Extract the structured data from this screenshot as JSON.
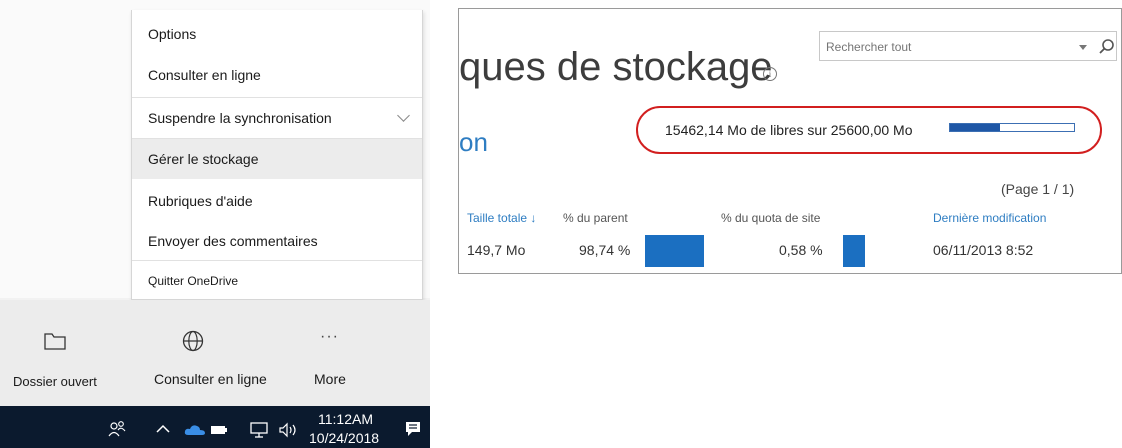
{
  "onedrive_menu": {
    "items": [
      {
        "label": "Options"
      },
      {
        "label": "Consulter en ligne"
      },
      {
        "label": "Suspendre la synchronisation"
      },
      {
        "label": "Gérer le stockage"
      },
      {
        "label": "Rubriques d'aide"
      },
      {
        "label": "Envoyer des commentaires"
      },
      {
        "label": "Quitter OneDrive"
      }
    ],
    "highlighted_item": "Gérer le stockage"
  },
  "action_bar": {
    "open_folder_label": "Dossier ouvert",
    "view_online_label": "Consulter en ligne",
    "more_label": "More",
    "more_glyph": "···",
    "icons": [
      "folder-icon",
      "globe-icon",
      "more-icon"
    ]
  },
  "taskbar": {
    "time": "11:12AM",
    "date": "10/24/2018",
    "icons": [
      "people-icon",
      "chevron-up-icon",
      "onedrive-cloud-icon",
      "battery-icon",
      "network-icon",
      "volume-icon",
      "notification-icon"
    ],
    "colors": {
      "background": "#0b1a2e",
      "cloud": "#3a8ee6"
    }
  },
  "storage_page": {
    "title_visible": "ques de stockage",
    "subtitle_visible": "on",
    "search_placeholder": "Rechercher tout",
    "quota_text": "15462,14 Mo de libres sur 25600,00 Mo",
    "quota_used_fraction": 0.4,
    "page_indicator": "(Page 1 / 1)",
    "columns": [
      {
        "label": "Taille totale ↓",
        "style": "link"
      },
      {
        "label": "% du parent",
        "style": "plain"
      },
      {
        "label": "% du quota de site",
        "style": "plain"
      },
      {
        "label": "Dernière modification",
        "style": "link"
      }
    ],
    "rows": [
      {
        "total_size": "149,7 Mo",
        "pct_parent": "98,74 %",
        "pct_parent_fraction": 0.9874,
        "pct_quota": "0,58 %",
        "pct_quota_fraction": 0.0058,
        "last_modified": "06/11/2013 8:52"
      }
    ],
    "colors": {
      "accent": "#2e7dc2",
      "bar": "#1b6fc1",
      "highlight_ellipse": "#d21f1f"
    }
  }
}
